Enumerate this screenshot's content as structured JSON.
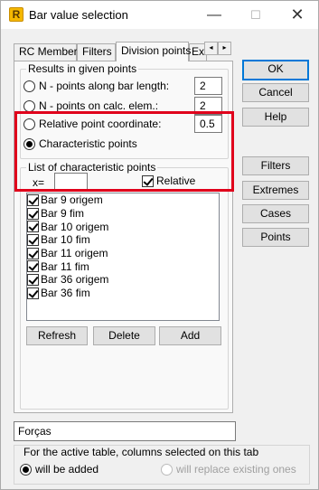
{
  "window": {
    "title": "Bar value selection",
    "icon": "R",
    "minimize": "—",
    "maximize": "☐",
    "close": "✕"
  },
  "tabs": [
    {
      "label": "RC Members"
    },
    {
      "label": "Filters"
    },
    {
      "label": "Division points"
    },
    {
      "label": "Ex"
    }
  ],
  "tab_scroll": {
    "left": "◂",
    "right": "▸"
  },
  "results": {
    "group_label": "Results in given points",
    "options": [
      {
        "label": "N - points along bar length:",
        "value": "2",
        "checked": false
      },
      {
        "label": "N - points on calc. elem.:",
        "value": "2",
        "checked": false
      },
      {
        "label": "Relative point coordinate:",
        "value": "0.5",
        "checked": false
      },
      {
        "label": "Characteristic points",
        "checked": true
      }
    ]
  },
  "char_points": {
    "group_label": "List of characteristic points",
    "x_label": "x=",
    "x_value": "",
    "relative_label": "Relative",
    "relative_checked": true,
    "items": [
      {
        "label": "Bar 9 origem",
        "checked": true
      },
      {
        "label": "Bar 9 fim",
        "checked": true
      },
      {
        "label": "Bar 10 origem",
        "checked": true
      },
      {
        "label": "Bar 10 fim",
        "checked": true
      },
      {
        "label": "Bar 11 origem",
        "checked": true
      },
      {
        "label": "Bar 11 fim",
        "checked": true
      },
      {
        "label": "Bar 36 origem",
        "checked": true
      },
      {
        "label": "Bar 36 fim",
        "checked": true
      }
    ],
    "buttons": {
      "refresh": "Refresh",
      "delete": "Delete",
      "add": "Add"
    }
  },
  "side_buttons": {
    "ok": "OK",
    "cancel": "Cancel",
    "help": "Help",
    "filters": "Filters",
    "extremes": "Extremes",
    "cases": "Cases",
    "points": "Points"
  },
  "name_field": {
    "value": "Forças"
  },
  "columns_group": {
    "label": "For the active table, columns selected on this tab",
    "option_added": "will be added",
    "option_replace": "will replace existing ones"
  },
  "colors": {
    "highlight": "#e0001b",
    "accent": "#0078d7"
  }
}
